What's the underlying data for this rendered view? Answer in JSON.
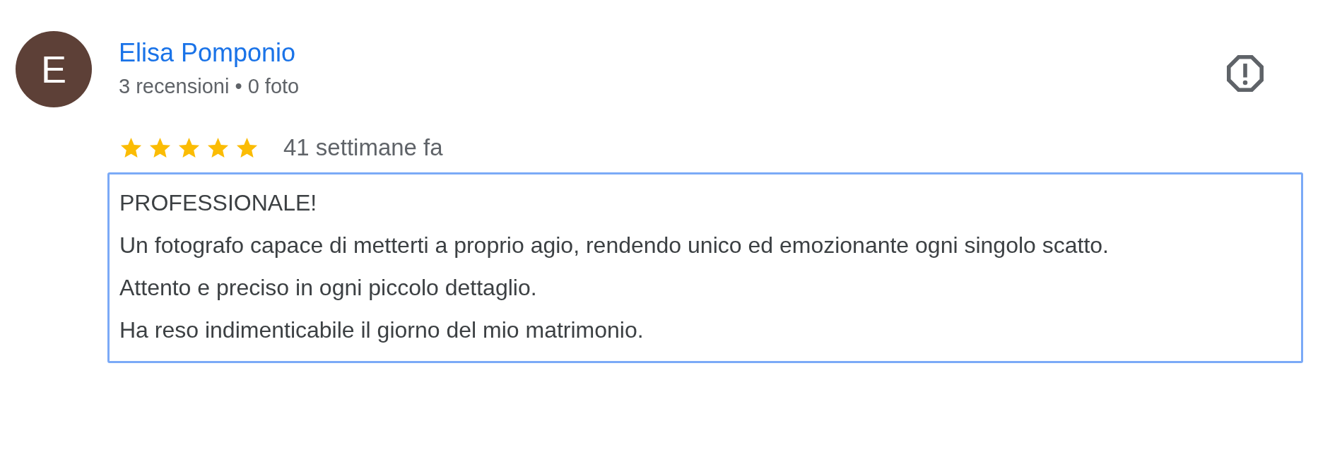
{
  "review": {
    "avatar_letter": "E",
    "author": "Elisa Pomponio",
    "author_meta": "3 recensioni • 0 foto",
    "stars": 5,
    "time": "41 settimane fa",
    "text_lines": [
      "PROFESSIONALE!",
      "Un fotografo capace di metterti a proprio agio, rendendo unico ed emozionante ogni singolo scatto.",
      "Attento e preciso in ogni piccolo dettaglio.",
      "Ha reso indimenticabile il giorno del mio matrimonio."
    ]
  }
}
